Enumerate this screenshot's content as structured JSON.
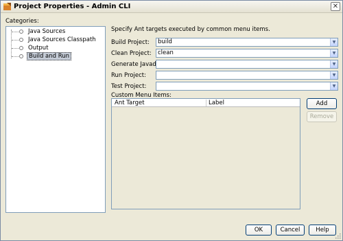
{
  "window": {
    "title": "Project Properties - Admin CLI",
    "close_glyph": "✕",
    "icon": "app-icon"
  },
  "categories": {
    "label": "Categories:",
    "items": [
      {
        "label": "Java Sources",
        "selected": false
      },
      {
        "label": "Java Sources Classpath",
        "selected": false
      },
      {
        "label": "Output",
        "selected": false
      },
      {
        "label": "Build and Run",
        "selected": true
      }
    ]
  },
  "main": {
    "description": "Specify Ant targets executed by common menu items.",
    "fields": [
      {
        "label": "Build Project:",
        "value": "build"
      },
      {
        "label": "Clean Project:",
        "value": "clean"
      },
      {
        "label": "Generate Javadoc:",
        "value": ""
      },
      {
        "label": "Run Project:",
        "value": ""
      },
      {
        "label": "Test Project:",
        "value": ""
      }
    ],
    "dropdown_glyph": "▼",
    "custom_menu_label": "Custom Menu Items:",
    "table": {
      "columns": [
        "Ant Target",
        "Label"
      ],
      "rows": []
    },
    "add_label": "Add",
    "remove_label": "Remove"
  },
  "footer": {
    "ok_label": "OK",
    "cancel_label": "Cancel",
    "help_label": "Help"
  },
  "colors": {
    "window_bg": "#ece9d8",
    "selection_bg": "#c5ccd7",
    "border_blue": "#7f9db9"
  }
}
